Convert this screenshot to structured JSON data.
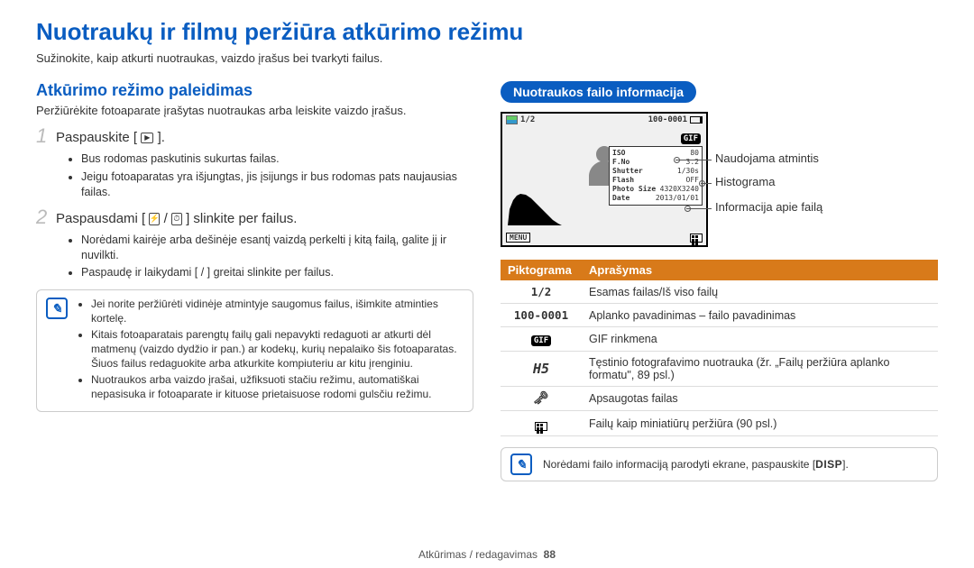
{
  "page": {
    "title": "Nuotraukų ir filmų peržiūra atkūrimo režimu",
    "subtitle": "Sužinokite, kaip atkurti nuotraukas, vaizdo įrašus bei tvarkyti failus."
  },
  "left": {
    "heading": "Atkūrimo režimo paleidimas",
    "sub": "Peržiūrėkite fotoaparate įrašytas nuotraukas arba leiskite vaizdo įrašus.",
    "step1_label": "Paspauskite [",
    "step1_after": "].",
    "step1_bullets": [
      "Bus rodomas paskutinis sukurtas failas.",
      "Jeigu fotoaparatas yra išjungtas, jis įsijungs ir bus rodomas pats naujausias failas."
    ],
    "step2_pre": "Paspausdami [",
    "step2_mid": "/",
    "step2_post": "] slinkite per failus.",
    "step2_bullets": [
      "Norėdami kairėje arba dešinėje esantį vaizdą perkelti į kitą failą, galite jį ir nuvilkti.",
      "Paspaudę ir laikydami [ / ] greitai slinkite per failus."
    ],
    "callout": [
      "Jei norite peržiūrėti vidinėje atmintyje saugomus failus, išimkite atminties kortelę.",
      "Kitais fotoaparatais parengtų failų gali nepavykti redaguoti ar atkurti dėl matmenų (vaizdo dydžio ir pan.) ar kodekų, kurių nepalaiko šis fotoaparatas. Šiuos failus redaguokite arba atkurkite kompiuteriu ar kitu įrenginiu.",
      "Nuotraukos arba vaizdo įrašai, užfiksuoti stačiu režimu, automatiškai nepasisuka ir fotoaparate ir kituose prietaisuose rodomi gulsčiu režimu."
    ]
  },
  "right": {
    "pill": "Nuotraukos failo informacija",
    "lcd": {
      "counter": "1/2",
      "folder_file": "100-0001",
      "gif_badge": "GIF",
      "info_rows": [
        {
          "k": "ISO",
          "v": "80"
        },
        {
          "k": "F.No",
          "v": "3.2"
        },
        {
          "k": "Shutter",
          "v": "1/30s"
        },
        {
          "k": "Flash",
          "v": "OFF"
        },
        {
          "k": "Photo Size",
          "v": "4320X3240"
        },
        {
          "k": "Date",
          "v": "2013/01/01"
        }
      ],
      "menu_label": "MENU"
    },
    "leaders": {
      "memory": "Naudojama atmintis",
      "histogram": "Histograma",
      "fileinfo": "Informacija apie failą"
    },
    "table": {
      "col1": "Piktograma",
      "col2": "Aprašymas",
      "rows": [
        {
          "icon": "1/2",
          "desc": "Esamas failas/Iš viso failų"
        },
        {
          "icon": "100-0001",
          "desc": "Aplanko pavadinimas – failo pavadinimas"
        },
        {
          "icon": "GIF",
          "desc": "GIF rinkmena"
        },
        {
          "icon": "H5",
          "desc": "Tęstinio fotografavimo nuotrauka (žr. „Failų peržiūra aplanko formatu\", 89 psl.)"
        },
        {
          "icon": "KEY",
          "desc": "Apsaugotas failas"
        },
        {
          "icon": "THUMBS",
          "desc": "Failų kaip miniatiūrų peržiūra (90 psl.)"
        }
      ]
    },
    "bottom_callout": "Norėdami failo informaciją parodyti ekrane, paspauskite [",
    "bottom_callout_key": "DISP",
    "bottom_callout_end": "]."
  },
  "footer": {
    "section": "Atkūrimas / redagavimas",
    "page": "88"
  }
}
